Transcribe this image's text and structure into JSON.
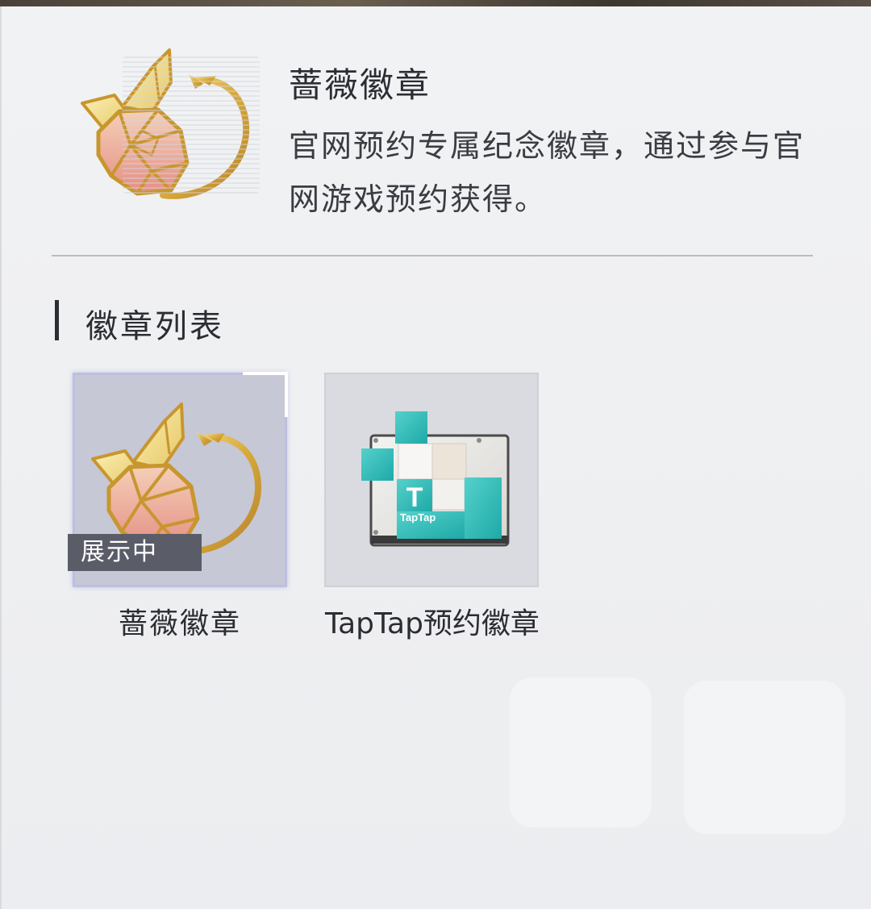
{
  "detail": {
    "title": "蔷薇徽章",
    "description": "官网预约专属纪念徽章，通过参与官网游戏预约获得。",
    "icon": "rose-badge-icon"
  },
  "badge_list": {
    "heading": "徽章列表",
    "items": [
      {
        "name": "蔷薇徽章",
        "icon": "rose-badge-icon",
        "tag": "展示中",
        "selected": true
      },
      {
        "name": "TapTap预约徽章",
        "icon": "taptap-badge-icon",
        "icon_text": "TapTap",
        "selected": false
      }
    ]
  },
  "colors": {
    "teal": "#2bb6b4",
    "gold": "#d7a93b",
    "rose": "#e9a89a",
    "selected_border": "#bdbfe0",
    "tag_bg": "#5a5c68"
  }
}
